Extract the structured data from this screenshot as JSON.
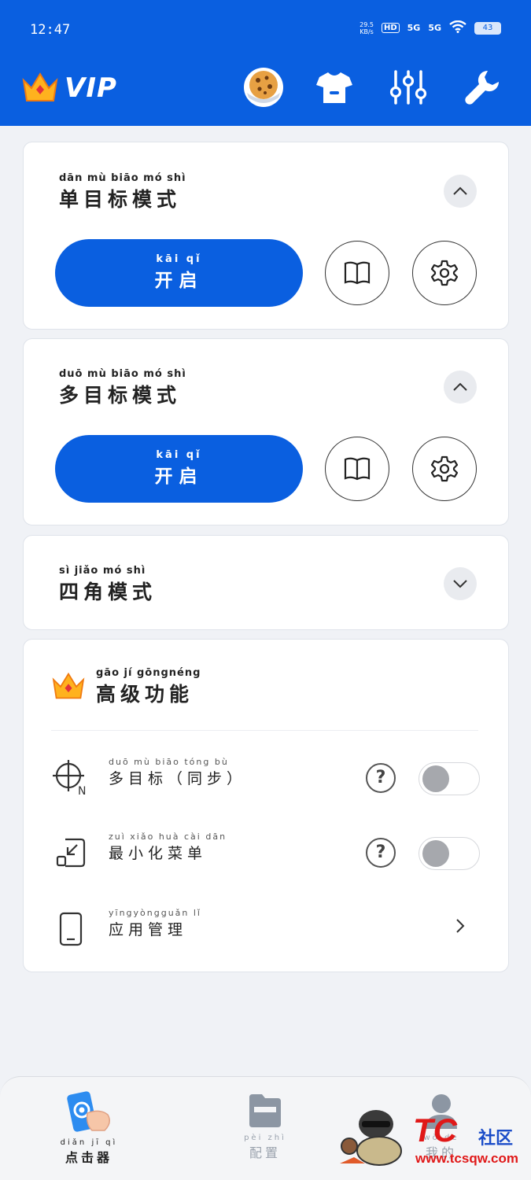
{
  "status_bar": {
    "time": "12:47",
    "net_speed": "29.5",
    "net_unit": "KB/s",
    "hd": "HD",
    "sim1": "5G",
    "sim2": "5G",
    "battery": "43"
  },
  "header": {
    "vip_label": "VIP",
    "icons": [
      "cookie-icon",
      "tshirt-icon",
      "sliders-icon",
      "wrench-icon"
    ]
  },
  "modes": [
    {
      "pinyin": "dān mù biāo mó shì",
      "title": "单目标模式",
      "expanded": true,
      "open_pinyin": "kāi qǐ",
      "open_label": "开启"
    },
    {
      "pinyin": "duō mù biāo mó shì",
      "title": "多目标模式",
      "expanded": true,
      "open_pinyin": "kāi qǐ",
      "open_label": "开启"
    },
    {
      "pinyin": "sì jiǎo mó shì",
      "title": "四角模式",
      "expanded": false
    }
  ],
  "advanced": {
    "pinyin": "gāo jí gōngnéng",
    "title": "高级功能",
    "rows": [
      {
        "pinyin": "duō mù biāo   tóng bù",
        "label": "多目标（同步）",
        "toggle": false
      },
      {
        "pinyin": "zuì xiǎo huà cài dān",
        "label": "最小化菜单",
        "toggle": false
      },
      {
        "pinyin": "yīngyòngguǎn lǐ",
        "label": "应用管理"
      }
    ]
  },
  "bottom_nav": [
    {
      "pinyin": "diǎn jī qì",
      "label": "点击器",
      "active": true
    },
    {
      "pinyin": "pèi zhì",
      "label": "配置",
      "active": false
    },
    {
      "pinyin": "wǒ de",
      "label": "我的",
      "active": false
    }
  ],
  "watermark": {
    "brand": "TC",
    "community": "社区",
    "url": "www.tcsqw.com"
  },
  "colors": {
    "primary": "#0a5fe0",
    "background": "#f0f2f6",
    "toggle_off": "#a6a8ad",
    "watermark_red": "#e01818"
  }
}
